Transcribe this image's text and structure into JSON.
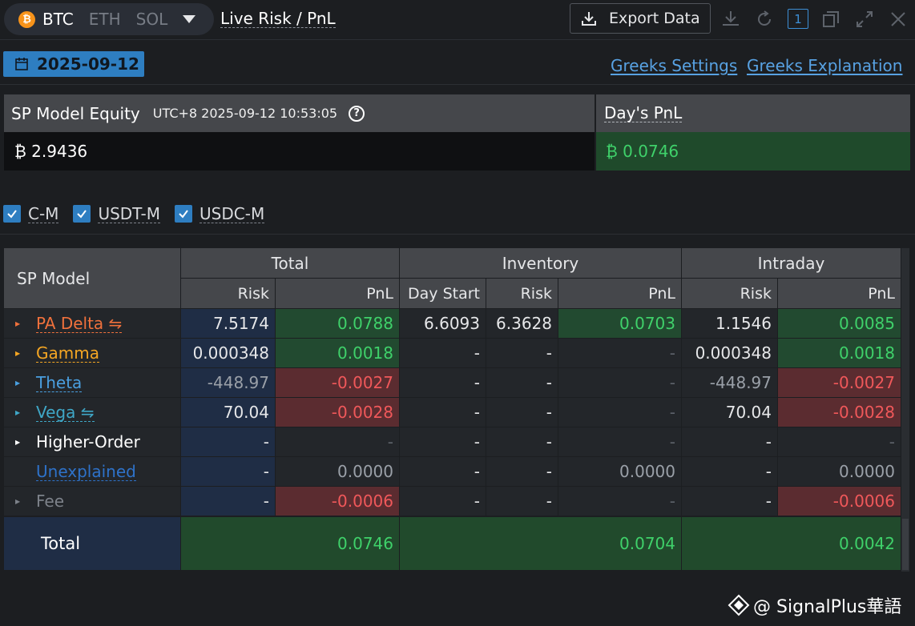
{
  "header": {
    "coin_tabs": [
      "BTC",
      "ETH",
      "SOL"
    ],
    "active_coin": "BTC",
    "btc_logo_glyph": "₿",
    "title": "Live Risk / PnL",
    "export_label": "Export Data",
    "window_number": "1"
  },
  "date_bar": {
    "date": "2025-09-12",
    "links": [
      "Greeks Settings",
      "Greeks Explanation"
    ]
  },
  "equity": {
    "title": "SP Model Equity",
    "timestamp": "UTC+8 2025-09-12 10:53:05",
    "value": "₿ 2.9436",
    "pnl_title": "Day's PnL",
    "pnl_value": "₿ 0.0746"
  },
  "filters": [
    "C-M",
    "USDT-M",
    "USDC-M"
  ],
  "table": {
    "corner_label": "SP Model",
    "groups": [
      "Total",
      "Inventory",
      "Intraday"
    ],
    "subheaders": [
      "Risk",
      "PnL",
      "Day Start",
      "Risk",
      "PnL",
      "Risk",
      "PnL"
    ],
    "rows": [
      {
        "label": "PA Delta ⇋",
        "color": "#f0713c",
        "arrow_color": "#f0713c",
        "cells": [
          "7.5174",
          "0.0788",
          "6.6093",
          "6.3628",
          "0.0703",
          "1.1546",
          "0.0085"
        ]
      },
      {
        "label": "Gamma",
        "color": "#f5a623",
        "arrow_color": "#f5a623",
        "cells": [
          "0.000348",
          "0.0018",
          "-",
          "-",
          "-",
          "0.000348",
          "0.0018"
        ]
      },
      {
        "label": "Theta",
        "color": "#4a9fe0",
        "arrow_color": "#4a9fe0",
        "cells": [
          "-448.97",
          "-0.0027",
          "-",
          "-",
          "-",
          "-448.97",
          "-0.0027"
        ]
      },
      {
        "label": "Vega ⇋",
        "color": "#3fa7c7",
        "arrow_color": "#3fa7c7",
        "cells": [
          "70.04",
          "-0.0028",
          "-",
          "-",
          "-",
          "70.04",
          "-0.0028"
        ]
      },
      {
        "label": "Higher-Order",
        "color": "#ffffff",
        "arrow_color": "#ffffff",
        "cells": [
          "-",
          "-",
          "-",
          "-",
          "-",
          "-",
          "-"
        ]
      },
      {
        "label": "Unexplained",
        "color": "#2e72c9",
        "arrow_color": "",
        "cells": [
          "-",
          "0.0000",
          "-",
          "-",
          "0.0000",
          "-",
          "0.0000"
        ]
      },
      {
        "label": "Fee",
        "color": "#7d828a",
        "arrow_color": "#7d828a",
        "cells": [
          "-",
          "-0.0006",
          "-",
          "-",
          "-",
          "-",
          "-0.0006"
        ]
      }
    ],
    "total": {
      "label": "Total",
      "values": [
        "0.0746",
        "0.0704",
        "0.0042"
      ]
    }
  },
  "watermark": "@ SignalPlus華語"
}
